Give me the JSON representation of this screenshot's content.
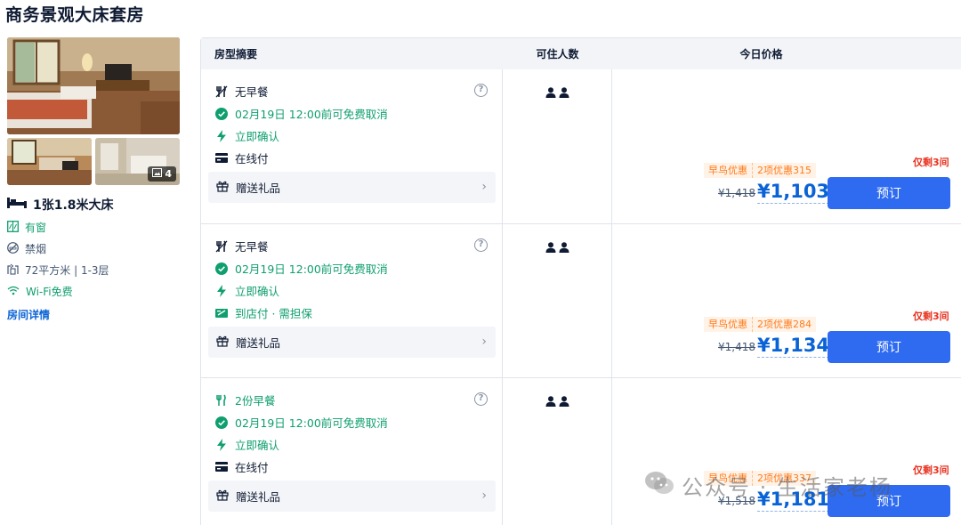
{
  "room": {
    "title": "商务景观大床套房",
    "photo_count": "4",
    "bed": "1张1.8米大床",
    "facilities": [
      "有窗",
      "禁烟",
      "72平方米 | 1-3层",
      "Wi-Fi免费"
    ],
    "detail_link": "房间详情"
  },
  "table": {
    "headers": {
      "summary": "房型摘要",
      "guests": "可住人数",
      "price": "今日价格"
    },
    "rows": [
      {
        "meal": "无早餐",
        "cancel": "02月19日 12:00前可免费取消",
        "confirm": "立即确认",
        "payment": "在线付",
        "gift": "赠送礼品",
        "only_left": "仅剩3间",
        "promo_early": "早鸟优惠",
        "promo_discount": "2项优惠315",
        "original_price": "¥1,418",
        "price": "¥1,103",
        "book": "预订"
      },
      {
        "meal": "无早餐",
        "cancel": "02月19日 12:00前可免费取消",
        "confirm": "立即确认",
        "payment": "到店付 · 需担保",
        "gift": "赠送礼品",
        "only_left": "仅剩3间",
        "promo_early": "早鸟优惠",
        "promo_discount": "2项优惠284",
        "original_price": "¥1,418",
        "price": "¥1,134",
        "book": "预订"
      },
      {
        "meal": "2份早餐",
        "cancel": "02月19日 12:00前可免费取消",
        "confirm": "立即确认",
        "payment": "在线付",
        "gift": "赠送礼品",
        "only_left": "仅剩3间",
        "promo_early": "早鸟优惠",
        "promo_discount": "2项优惠337",
        "original_price": "¥1,518",
        "price": "¥1,181",
        "book": "预订"
      }
    ]
  },
  "watermark": "公众号 · 生活家老杨",
  "colors": {
    "accent": "#2e6bf0",
    "price": "#0a63d6",
    "green": "#0f9f6e",
    "alert": "#e8321f",
    "promo": "#ff7a1a"
  }
}
